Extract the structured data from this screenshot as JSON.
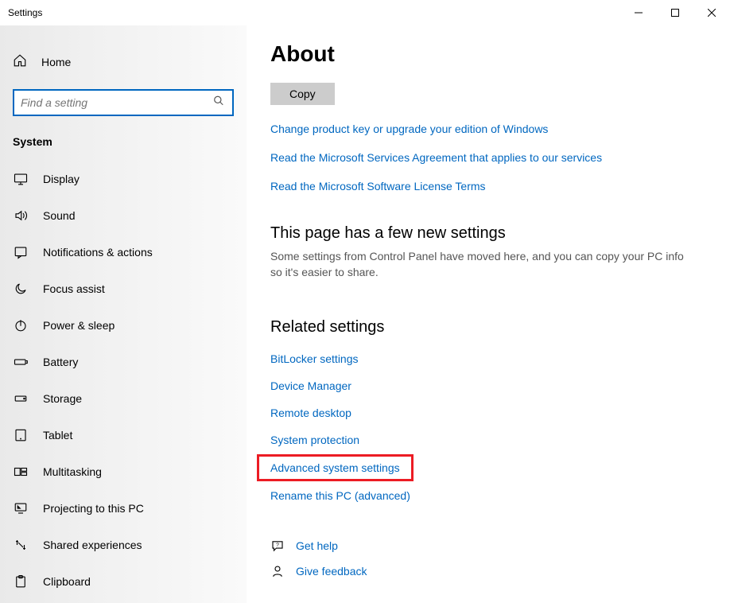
{
  "titlebar": {
    "title": "Settings"
  },
  "sidebar": {
    "home_label": "Home",
    "search_placeholder": "Find a setting",
    "category": "System",
    "items": [
      {
        "label": "Display"
      },
      {
        "label": "Sound"
      },
      {
        "label": "Notifications & actions"
      },
      {
        "label": "Focus assist"
      },
      {
        "label": "Power & sleep"
      },
      {
        "label": "Battery"
      },
      {
        "label": "Storage"
      },
      {
        "label": "Tablet"
      },
      {
        "label": "Multitasking"
      },
      {
        "label": "Projecting to this PC"
      },
      {
        "label": "Shared experiences"
      },
      {
        "label": "Clipboard"
      }
    ]
  },
  "content": {
    "title": "About",
    "copy_label": "Copy",
    "links": [
      "Change product key or upgrade your edition of Windows",
      "Read the Microsoft Services Agreement that applies to our services",
      "Read the Microsoft Software License Terms"
    ],
    "new_settings_heading": "This page has a few new settings",
    "new_settings_text": "Some settings from Control Panel have moved here, and you can copy your PC info so it's easier to share.",
    "related_heading": "Related settings",
    "related": [
      {
        "label": "BitLocker settings"
      },
      {
        "label": "Device Manager"
      },
      {
        "label": "Remote desktop"
      },
      {
        "label": "System protection"
      },
      {
        "label": "Advanced system settings",
        "highlight": true
      },
      {
        "label": "Rename this PC (advanced)"
      }
    ],
    "help": [
      {
        "label": "Get help"
      },
      {
        "label": "Give feedback"
      }
    ]
  }
}
